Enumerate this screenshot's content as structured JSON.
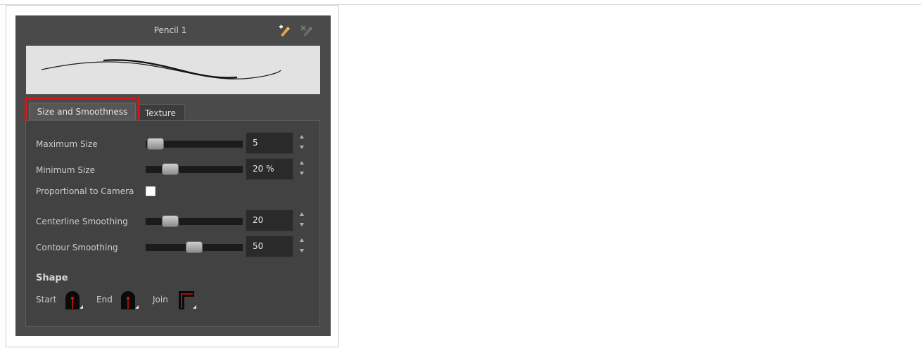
{
  "panel": {
    "title": "Pencil 1"
  },
  "tabs": {
    "size_and_smoothness": "Size and Smoothness",
    "texture": "Texture"
  },
  "fields": {
    "maximum_size": {
      "label": "Maximum Size",
      "value": "5",
      "slider_fraction": 0.02
    },
    "minimum_size": {
      "label": "Minimum Size",
      "value": "20 %",
      "slider_fraction": 0.2
    },
    "proportional": {
      "label": "Proportional to Camera",
      "checked": false
    },
    "centerline_smoothing": {
      "label": "Centerline Smoothing",
      "value": "20",
      "slider_fraction": 0.2
    },
    "contour_smoothing": {
      "label": "Contour Smoothing",
      "value": "50",
      "slider_fraction": 0.5
    }
  },
  "shape": {
    "title": "Shape",
    "start_label": "Start",
    "end_label": "End",
    "join_label": "Join"
  },
  "colors": {
    "panel_bg": "#4a4a4a",
    "highlight": "#e01010",
    "endpoint": "#e01010"
  },
  "icons": [
    "new-preset-icon",
    "delete-preset-icon",
    "round-cap-start-icon",
    "round-cap-end-icon",
    "mitre-join-icon"
  ]
}
